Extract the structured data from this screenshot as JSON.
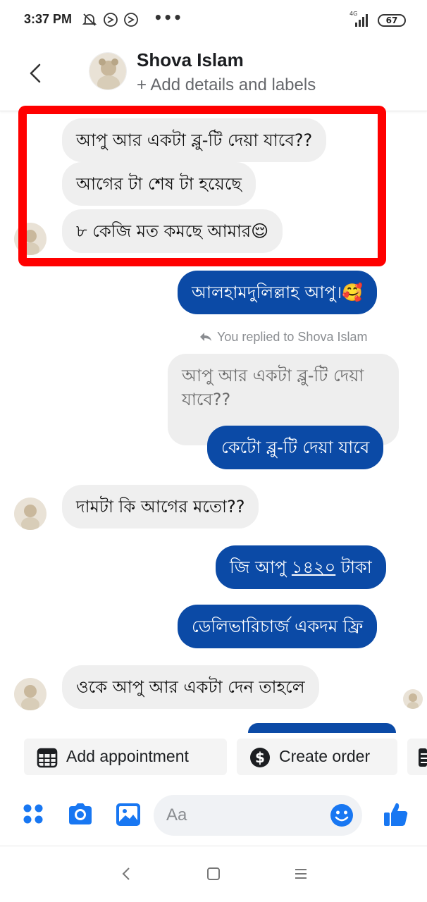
{
  "status_bar": {
    "time": "3:37 PM",
    "icons": [
      "muted-bell-icon",
      "sync-icon",
      "sync-icon"
    ],
    "more": "•••",
    "network": "4G",
    "battery": "67"
  },
  "header": {
    "contact_name": "Shova Islam",
    "subtitle": "+ Add details and labels"
  },
  "messages": [
    {
      "side": "in",
      "text": "আপু আর একটা ব্লু-টি দেয়া যাবে??"
    },
    {
      "side": "in",
      "text": "আগের টা শেষ টা হয়েছে"
    },
    {
      "side": "in",
      "text": "৮ কেজি মত কমছে আমার😌"
    },
    {
      "side": "out",
      "text": "আলহামদুলিল্লাহ আপু।🥰"
    },
    {
      "side": "meta",
      "text": "You replied to Shova Islam"
    },
    {
      "side": "quoted",
      "text": "আপু আর একটা ব্লু-টি দেয়া যাবে??"
    },
    {
      "side": "out",
      "text": "কেটো ব্লু-টি দেয়া যাবে"
    },
    {
      "side": "in",
      "text": "দামটা কি আগের মতো??"
    },
    {
      "side": "out",
      "text_prefix": "জি আপু ",
      "text_link": "১৪২০",
      "text_suffix": " টাকা"
    },
    {
      "side": "out",
      "text": "ডেলিভারিচার্জ একদম ফ্রি"
    },
    {
      "side": "in",
      "text": "ওকে আপু আর একটা দেন তাহলে"
    }
  ],
  "quick_actions": [
    {
      "label": "Add appointment",
      "icon": "calendar-icon"
    },
    {
      "label": "Create order",
      "icon": "dollar-icon"
    }
  ],
  "composer": {
    "placeholder": "Aa",
    "icons": [
      "menu-dots-icon",
      "camera-icon",
      "gallery-icon",
      "emoji-icon",
      "like-icon"
    ]
  },
  "colors": {
    "outgoing_bubble": "#0b4aa6",
    "incoming_bubble": "#efefef",
    "highlight_box": "#ff0000",
    "accent": "#1877f2"
  }
}
